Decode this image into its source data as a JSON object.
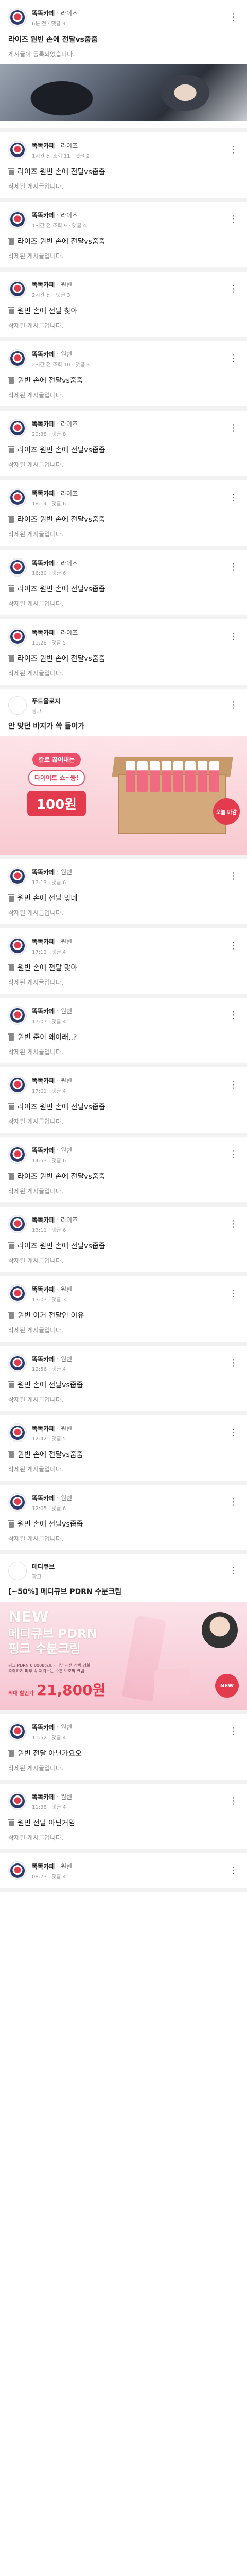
{
  "posts": [
    {
      "author": "똑똑카페",
      "category": "라이즈",
      "time": "2분 전",
      "stats": "6분 전 · 댓글 3",
      "title": "라이즈 원빈 손에 전달vs줍줍",
      "body": "게시글이 등록되었습니다.",
      "deleted": false,
      "photo": true
    },
    {
      "author": "똑똑카페",
      "category": "라이즈",
      "stats": "1시간 전 조회 11 · 댓글 2",
      "title": "라이즈 원빈 손에 전달vs줍줍",
      "body": "삭제된 게시글입니다.",
      "deleted": true
    },
    {
      "author": "똑똑카페",
      "category": "라이즈",
      "stats": "1시간 전 조회 9 · 댓글 4",
      "title": "라이즈 원빈 손에 전달vs줍줍",
      "body": "삭제된 게시글입니다.",
      "deleted": true
    },
    {
      "author": "똑똑카페",
      "category": "원빈",
      "stats": "2시간 전 · 댓글 3",
      "title": "원빈 손에 전달 찾아",
      "body": "삭제된 게시글입니다.",
      "deleted": true
    },
    {
      "author": "똑똑카페",
      "category": "원빈",
      "stats": "2시간 전 조회 10 · 댓글 3",
      "title": "원빈 손에 전달vs줍줍",
      "body": "삭제된 게시글입니다.",
      "deleted": true
    },
    {
      "author": "똑똑카페",
      "category": "라이즈",
      "stats": "20:38 · 댓글 8",
      "title": "라이즈 원빈 손에 전달vs줍줍",
      "body": "삭제된 게시글입니다.",
      "deleted": true
    },
    {
      "author": "똑똑카페",
      "category": "라이즈",
      "stats": "18:14 · 댓글 6",
      "title": "라이즈 원빈 손에 전달vs줍줍",
      "body": "삭제된 게시글입니다.",
      "deleted": true
    },
    {
      "author": "똑똑카페",
      "category": "라이즈",
      "stats": "16:30 · 댓글 6",
      "title": "라이즈 원빈 손에 전달vs줍줍",
      "body": "삭제된 게시글입니다.",
      "deleted": true
    },
    {
      "author": "똑똑카페",
      "category": "라이즈",
      "stats": "11:28 · 댓글 5",
      "title": "라이즈 원빈 손에 전달vs줍줍",
      "body": "삭제된 게시글입니다.",
      "deleted": true
    }
  ],
  "ad1": {
    "name": "푸드올로지",
    "sub": "광고",
    "title": "안 맞던 바지가 쏙 들어가",
    "pill1": "칼로 끊어내는",
    "pill2": "다이어트 쇼~등!",
    "price": "100원",
    "badge": "오늘 마감"
  },
  "posts2": [
    {
      "author": "똑똑카페",
      "category": "원빈",
      "stats": "17:13 · 댓글 6",
      "title": "원빈 손에 전달 맞네",
      "body": "삭제된 게시글입니다."
    },
    {
      "author": "똑똑카페",
      "category": "원빈",
      "stats": "17:12 · 댓글 4",
      "title": "원빈 손에 전달 맞아",
      "body": "삭제된 게시글입니다."
    },
    {
      "author": "똑똑카페",
      "category": "원빈",
      "stats": "17:07 · 댓글 4",
      "title": "원빈 준이 왜이래..?",
      "body": "삭제된 게시글입니다."
    },
    {
      "author": "똑똑카페",
      "category": "원빈",
      "stats": "17:01 · 댓글 4",
      "title": "라이즈 원빈 손에 전달vs줍줍",
      "body": "삭제된 게시글입니다."
    },
    {
      "author": "똑똑카페",
      "category": "원빈",
      "stats": "14:53 · 댓글 6",
      "title": "라이즈 원빈 손에 전달vs줍줍",
      "body": "삭제된 게시글입니다."
    },
    {
      "author": "똑똑카페",
      "category": "라이즈",
      "stats": "13:11 · 댓글 6",
      "title": "라이즈 원빈 손에 전달vs줍줍",
      "body": "삭제된 게시글입니다."
    },
    {
      "author": "똑똑카페",
      "category": "원빈",
      "stats": "13:03 · 댓글 3",
      "title": "원빈 이거 전달인 이유",
      "body": "삭제된 게시글입니다."
    },
    {
      "author": "똑똑카페",
      "category": "원빈",
      "stats": "12:56 · 댓글 4",
      "title": "원빈 손에 전달vs줍줍",
      "body": "삭제된 게시글입니다."
    },
    {
      "author": "똑똑카페",
      "category": "원빈",
      "stats": "12:42 · 댓글 5",
      "title": "원빈 손에 전달vs줍줍",
      "body": "삭제된 게시글입니다."
    },
    {
      "author": "똑똑카페",
      "category": "원빈",
      "stats": "12:05 · 댓글 6",
      "title": "원빈 손에 전달vs줍줍",
      "body": "삭제된 게시글입니다."
    }
  ],
  "ad2": {
    "name": "메디큐브",
    "sub": "광고",
    "title": "[~50%] 메디큐브 PDRN 수분크림",
    "new": "NEW",
    "main1": "메디큐브 PDRN",
    "main2": "핑크 수분크림",
    "desc1": "핑크 PDRN 0.0008%로 · 피부 재생 장벽 강화",
    "desc2": "촉촉하게 피부 속 채워주는 수분 보호막 크림",
    "price_label": "최대 할인가",
    "price": "21,800원",
    "badge": "NEW"
  },
  "posts3": [
    {
      "author": "똑똑카페",
      "category": "원빈",
      "stats": "11:52 · 댓글 4",
      "title": "원빈 전달 아닌가요오",
      "body": "삭제된 게시글입니다."
    },
    {
      "author": "똑똑카페",
      "category": "원빈",
      "stats": "11:38 · 댓글 4",
      "title": "원빈 전달 아닌거임",
      "body": "삭제된 게시글입니다."
    },
    {
      "author": "똑똑카페",
      "category": "원빈",
      "stats": "08:73 · 댓글 4",
      "title": "",
      "body": ""
    }
  ]
}
